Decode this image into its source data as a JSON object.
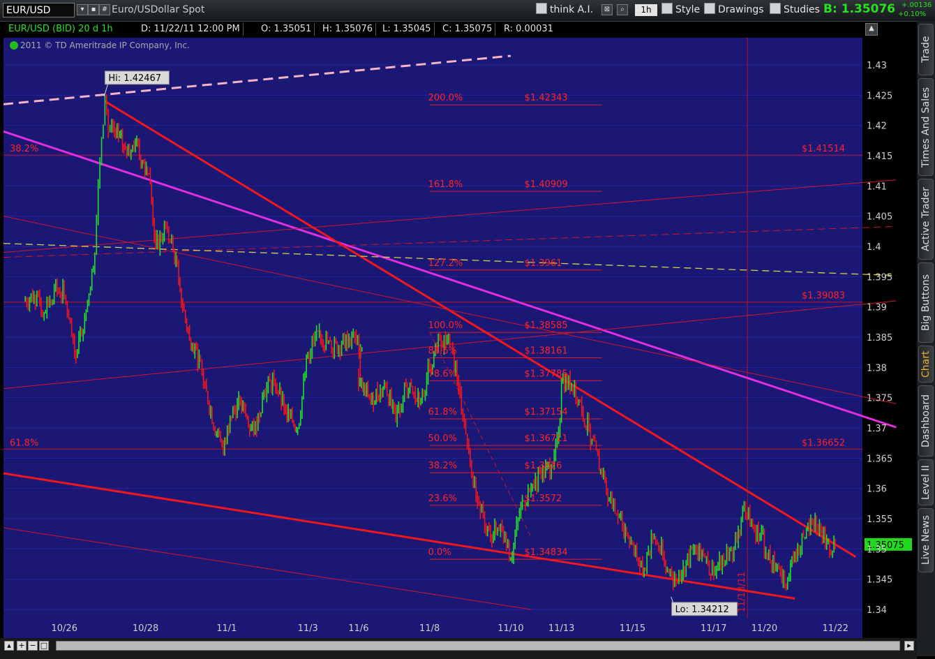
{
  "toolbar": {
    "symbol": "EUR/USD",
    "description": "Euro/USDollar Spot",
    "think_label": "think A.I.",
    "timeframe": "1h",
    "style_label": "Style",
    "drawings_label": "Drawings",
    "studies_label": "Studies",
    "bid": "B: 1.35076",
    "change_abs": "+.00136",
    "change_pct": "+0.10%"
  },
  "infobar": {
    "symbol_label": "EUR/USD (BID) 20 d 1h",
    "date": "D: 11/22/11 12:00 PM",
    "open": "O: 1.35051",
    "high": "H: 1.35076",
    "low": "L: 1.35045",
    "close": "C: 1.35075",
    "range": "R: 0.00031"
  },
  "copyright": "2011 © TD Ameritrade IP Company, Inc.",
  "sidetabs": [
    "Trade",
    "Times And Sales",
    "Active Trader",
    "Big Buttons",
    "Chart",
    "Dashboard",
    "Level II",
    "Live News"
  ],
  "chart_data": {
    "type": "line",
    "title": "EUR/USD (BID) 20 d 1h",
    "ylim": [
      1.3385,
      1.4345
    ],
    "y_ticks": [
      1.34,
      1.345,
      1.35,
      1.355,
      1.36,
      1.365,
      1.37,
      1.375,
      1.38,
      1.385,
      1.39,
      1.395,
      1.4,
      1.405,
      1.41,
      1.415,
      1.42,
      1.425,
      1.43
    ],
    "x_tick_labels": [
      "10/26",
      "10/28",
      "11/1",
      "11/3",
      "11/6",
      "11/8",
      "11/10",
      "11/13",
      "11/15",
      "11/17",
      "11/20",
      "11/22"
    ],
    "series": [
      {
        "x": [
          "10/25 12:00",
          "10/25 18:00",
          "10/26 00:00",
          "10/26 06:00",
          "10/26 12:00",
          "10/26 18:00",
          "10/27 00:00",
          "10/27 06:00",
          "10/27 08:00",
          "10/27 10:00",
          "10/27 12:00",
          "10/27 14:00",
          "10/27 16:00",
          "10/27 20:00",
          "10/28 00:00",
          "10/28 06:00",
          "10/28 10:00",
          "10/28 14:00",
          "10/28 18:00",
          "10/31 00:00",
          "10/31 06:00",
          "10/31 10:00",
          "10/31 14:00",
          "10/31 18:00",
          "11/1 00:00",
          "11/1 06:00",
          "11/1 10:00",
          "11/1 14:00",
          "11/1 20:00",
          "11/2 04:00",
          "11/2 10:00",
          "11/2 16:00",
          "11/2 22:00",
          "11/3 06:00",
          "11/3 12:00",
          "11/3 18:00",
          "11/4 02:00",
          "11/4 08:00",
          "11/4 14:00",
          "11/4 20:00",
          "11/6 18:00",
          "11/7 02:00",
          "11/7 10:00",
          "11/7 16:00",
          "11/7 22:00",
          "11/8 06:00",
          "11/8 12:00",
          "11/8 18:00",
          "11/9 00:00",
          "11/9 06:00",
          "11/9 12:00",
          "11/9 18:00",
          "11/10 00:00",
          "11/10 06:00",
          "11/10 12:00",
          "11/10 18:00",
          "11/11 00:00",
          "11/11 06:00",
          "11/11 12:00",
          "11/11 18:00",
          "11/13 18:00",
          "11/14 00:00",
          "11/14 06:00",
          "11/14 12:00",
          "11/14 18:00",
          "11/15 00:00",
          "11/15 06:00",
          "11/15 12:00",
          "11/15 18:00",
          "11/16 00:00",
          "11/16 06:00",
          "11/16 12:00",
          "11/16 18:00",
          "11/17 00:00",
          "11/17 06:00",
          "11/17 12:00",
          "11/17 18:00",
          "11/18 00:00",
          "11/18 06:00",
          "11/18 12:00",
          "11/18 18:00",
          "11/20 18:00",
          "11/21 00:00",
          "11/21 06:00",
          "11/21 12:00",
          "11/21 18:00",
          "11/22 00:00",
          "11/22 06:00",
          "11/22 12:00"
        ],
        "y": [
          1.391,
          1.392,
          1.389,
          1.393,
          1.392,
          1.382,
          1.388,
          1.399,
          1.41,
          1.418,
          1.4246,
          1.419,
          1.42,
          1.418,
          1.416,
          1.417,
          1.414,
          1.412,
          1.4,
          1.403,
          1.398,
          1.39,
          1.385,
          1.383,
          1.376,
          1.369,
          1.366,
          1.372,
          1.374,
          1.369,
          1.376,
          1.378,
          1.373,
          1.37,
          1.382,
          1.386,
          1.383,
          1.384,
          1.385,
          1.383,
          1.377,
          1.375,
          1.377,
          1.371,
          1.377,
          1.374,
          1.38,
          1.385,
          1.384,
          1.376,
          1.364,
          1.356,
          1.352,
          1.354,
          1.3483,
          1.357,
          1.36,
          1.362,
          1.364,
          1.371,
          1.3778,
          1.377,
          1.373,
          1.368,
          1.362,
          1.357,
          1.354,
          1.351,
          1.346,
          1.352,
          1.349,
          1.344,
          1.347,
          1.35,
          1.349,
          1.346,
          1.348,
          1.35,
          1.357,
          1.353,
          1.352,
          1.349,
          1.347,
          1.3438,
          1.349,
          1.352,
          1.355,
          1.351,
          1.35075
        ]
      }
    ],
    "hi_label": "Hi: 1.42467",
    "lo_label": "Lo: 1.34212",
    "last_price_label": "1.35075",
    "date_annotation": "11/18/11",
    "fibonacci_extension": {
      "levels": [
        {
          "pct": "200.0%",
          "price": "$1.42343",
          "value": 1.4234
        },
        {
          "pct": "161.8%",
          "price": "$1.40909",
          "value": 1.4091
        },
        {
          "pct": "127.2%",
          "price": "$1.3961",
          "value": 1.3961
        },
        {
          "pct": "100.0%",
          "price": "$1.38585",
          "value": 1.3858
        },
        {
          "pct": "88.6%",
          "price": "$1.38161",
          "value": 1.3816
        },
        {
          "pct": "78.6%",
          "price": "$1.37785",
          "value": 1.3778
        },
        {
          "pct": "61.8%",
          "price": "$1.37154",
          "value": 1.3715
        },
        {
          "pct": "50.0%",
          "price": "$1.36711",
          "value": 1.3671
        },
        {
          "pct": "38.2%",
          "price": "$1.3626",
          "value": 1.3626
        },
        {
          "pct": "23.6%",
          "price": "$1.3572",
          "value": 1.3572
        },
        {
          "pct": "0.0%",
          "price": "$1.34834",
          "value": 1.3483
        }
      ]
    },
    "horizontal_levels": [
      {
        "pct": "38.2%",
        "price": "$1.41514",
        "value": 1.4151
      },
      {
        "pct": "",
        "price": "$1.39083",
        "value": 1.3908
      },
      {
        "pct": "61.8%",
        "price": "$1.36652",
        "value": 1.3665
      }
    ],
    "trendlines": [
      {
        "style": "dashed-pink",
        "from": [
          "10/25 00:00",
          1.4235
        ],
        "to": [
          "11/10 12:00",
          1.4315
        ]
      },
      {
        "style": "magenta",
        "from": [
          "10/25 00:00",
          1.419
        ],
        "to": [
          "11/24 00:00",
          1.3701
        ]
      },
      {
        "style": "red-thick",
        "from": [
          "10/27 12:00",
          1.424
        ],
        "to": [
          "11/23 00:00",
          1.3487
        ]
      },
      {
        "style": "red-thick",
        "from": [
          "10/25 00:00",
          1.3625
        ],
        "to": [
          "11/21 12:00",
          1.3418
        ]
      },
      {
        "style": "red-thin",
        "from": [
          "10/25 00:00",
          1.3765
        ],
        "to": [
          "11/24 00:00",
          1.391
        ]
      },
      {
        "style": "red-thin",
        "from": [
          "10/25 00:00",
          1.399
        ],
        "to": [
          "11/24 00:00",
          1.411
        ]
      },
      {
        "style": "red-thin",
        "from": [
          "10/25 00:00",
          1.405
        ],
        "to": [
          "11/24 00:00",
          1.374
        ]
      },
      {
        "style": "red-dashed",
        "from": [
          "10/25 00:00",
          1.3982
        ],
        "to": [
          "11/24 00:00",
          1.4033
        ]
      },
      {
        "style": "red-thin",
        "from": [
          "10/25 00:00",
          1.3535
        ],
        "to": [
          "11/11 00:00",
          1.34
        ]
      },
      {
        "style": "yellow-dashed",
        "from": [
          "10/25 00:00",
          1.4005
        ],
        "to": [
          "11/24 00:00",
          1.3952
        ]
      },
      {
        "style": "red-dashed-thin",
        "from": [
          "11/8 12:00",
          1.3858
        ],
        "to": [
          "11/11 00:00",
          1.352
        ]
      }
    ]
  }
}
